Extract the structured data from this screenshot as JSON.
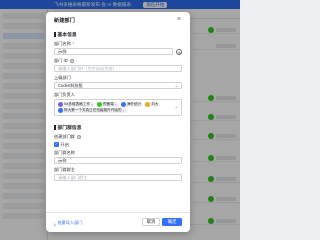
{
  "banner": {
    "text": "飞书多维表格最新发布 会 AI 数据报表",
    "button": "现在开始"
  },
  "modal": {
    "title": "新建部门",
    "close_icon": "close-icon",
    "section_basic": "基本信息",
    "dept_name_label": "部门名称",
    "dept_name_value": "示例",
    "dept_id_label": "部门 ID",
    "dept_id_placeholder": "请输入部门ID（为空自动生成）",
    "parent_label": "上级部门",
    "parent_value": "Codes科技股",
    "leader_label": "部门负责人",
    "members": [
      {
        "name": "Sa多维表格工作",
        "color": "#7a5af8"
      },
      {
        "name": "预备端",
        "color": "#34c724"
      },
      {
        "name": "海外统计",
        "color": "#3370ff"
      },
      {
        "name": "刘大",
        "color": "#f5a623"
      }
    ],
    "members_second_line": "阿大第一个天真正在班级路外开始的",
    "section_group": "部门群信息",
    "create_group_label": "创建部门群",
    "create_group_checkbox_label": "开启",
    "group_name_label": "部门群名称",
    "group_name_value": "示例",
    "group_owner_label": "部门群群主",
    "group_owner_placeholder": "请输入部门群主",
    "footer_link": "批量导入部门",
    "cancel": "取消",
    "confirm": "确定"
  }
}
